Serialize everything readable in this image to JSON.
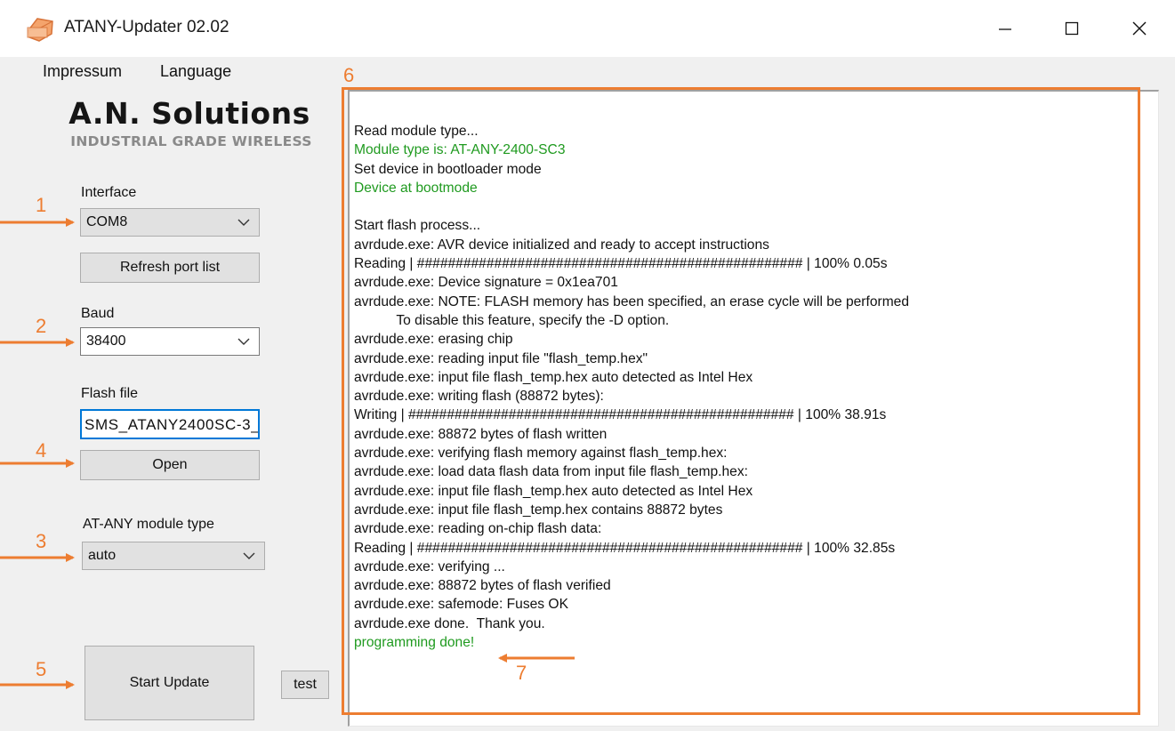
{
  "window": {
    "title": "ATANY-Updater 02.02",
    "controls": [
      "minimize-icon",
      "maximize-icon",
      "close-icon"
    ]
  },
  "menu": [
    "Impressum",
    "Language"
  ],
  "brand": {
    "name": "A.N. Solutions",
    "tagline": "INDUSTRIAL GRADE WIRELESS"
  },
  "interface": {
    "label": "Interface",
    "selected": "COM8",
    "refresh_button": "Refresh port list"
  },
  "baud": {
    "label": "Baud",
    "selected": "38400"
  },
  "flash_file": {
    "label": "Flash file",
    "value": "SMS_ATANY2400SC-3_",
    "open_button": "Open"
  },
  "module_type": {
    "label": "AT-ANY module type",
    "selected": "auto"
  },
  "actions": {
    "start_update": "Start Update",
    "test": "test"
  },
  "log": [
    {
      "text": "Read module type...",
      "status": "normal"
    },
    {
      "text": "Module type is: AT-ANY-2400-SC3",
      "status": "success"
    },
    {
      "text": "Set device in bootloader mode",
      "status": "normal"
    },
    {
      "text": "Device at bootmode",
      "status": "success"
    },
    {
      "text": "",
      "status": "normal"
    },
    {
      "text": "Start flash process...",
      "status": "normal"
    },
    {
      "text": "avrdude.exe: AVR device initialized and ready to accept instructions",
      "status": "normal"
    },
    {
      "text": "Reading | ################################################## | 100% 0.05s",
      "status": "normal"
    },
    {
      "text": "avrdude.exe: Device signature = 0x1ea701",
      "status": "normal"
    },
    {
      "text": "avrdude.exe: NOTE: FLASH memory has been specified, an erase cycle will be performed",
      "status": "normal"
    },
    {
      "text": "           To disable this feature, specify the -D option.",
      "status": "normal"
    },
    {
      "text": "avrdude.exe: erasing chip",
      "status": "normal"
    },
    {
      "text": "avrdude.exe: reading input file \"flash_temp.hex\"",
      "status": "normal"
    },
    {
      "text": "avrdude.exe: input file flash_temp.hex auto detected as Intel Hex",
      "status": "normal"
    },
    {
      "text": "avrdude.exe: writing flash (88872 bytes):",
      "status": "normal"
    },
    {
      "text": "Writing | ################################################## | 100% 38.91s",
      "status": "normal"
    },
    {
      "text": "avrdude.exe: 88872 bytes of flash written",
      "status": "normal"
    },
    {
      "text": "avrdude.exe: verifying flash memory against flash_temp.hex:",
      "status": "normal"
    },
    {
      "text": "avrdude.exe: load data flash data from input file flash_temp.hex:",
      "status": "normal"
    },
    {
      "text": "avrdude.exe: input file flash_temp.hex auto detected as Intel Hex",
      "status": "normal"
    },
    {
      "text": "avrdude.exe: input file flash_temp.hex contains 88872 bytes",
      "status": "normal"
    },
    {
      "text": "avrdude.exe: reading on-chip flash data:",
      "status": "normal"
    },
    {
      "text": "Reading | ################################################## | 100% 32.85s",
      "status": "normal"
    },
    {
      "text": "avrdude.exe: verifying ...",
      "status": "normal"
    },
    {
      "text": "avrdude.exe: 88872 bytes of flash verified",
      "status": "normal"
    },
    {
      "text": "avrdude.exe: safemode: Fuses OK",
      "status": "normal"
    },
    {
      "text": "avrdude.exe done.  Thank you.",
      "status": "normal"
    },
    {
      "text": "programming done!",
      "status": "success"
    }
  ],
  "annotations": {
    "numbers": [
      "1",
      "2",
      "4",
      "3",
      "5",
      "6",
      "7"
    ],
    "color": "#ed7d31"
  },
  "colors": {
    "success_text": "#1f9a1f",
    "window_bg": "#f0f0f0",
    "button_bg": "#e1e1e1",
    "focus_border": "#0078d7"
  }
}
